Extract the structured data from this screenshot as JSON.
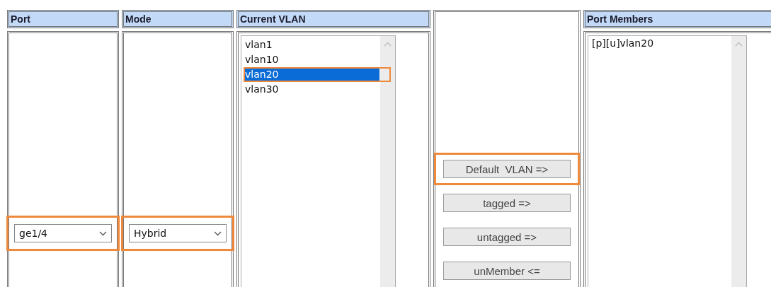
{
  "port": {
    "heading": "Port",
    "value": "ge1/4",
    "highlighted": true
  },
  "mode": {
    "heading": "Mode",
    "value": "Hybrid",
    "highlighted": true
  },
  "current_vlan": {
    "heading": "Current VLAN",
    "items": [
      {
        "label": "vlan1",
        "selected": false,
        "highlighted": false
      },
      {
        "label": "vlan10",
        "selected": false,
        "highlighted": false
      },
      {
        "label": "vlan20",
        "selected": true,
        "highlighted": true
      },
      {
        "label": "vlan30",
        "selected": false,
        "highlighted": false
      }
    ]
  },
  "actions": [
    {
      "label": "Default  VLAN =>",
      "highlighted": true
    },
    {
      "label": "tagged =>",
      "highlighted": false
    },
    {
      "label": "untagged =>",
      "highlighted": false
    },
    {
      "label": "unMember <=",
      "highlighted": false
    }
  ],
  "port_members": {
    "heading": "Port Members",
    "items": [
      {
        "label": "[p][u]vlan20",
        "selected": false
      }
    ]
  }
}
